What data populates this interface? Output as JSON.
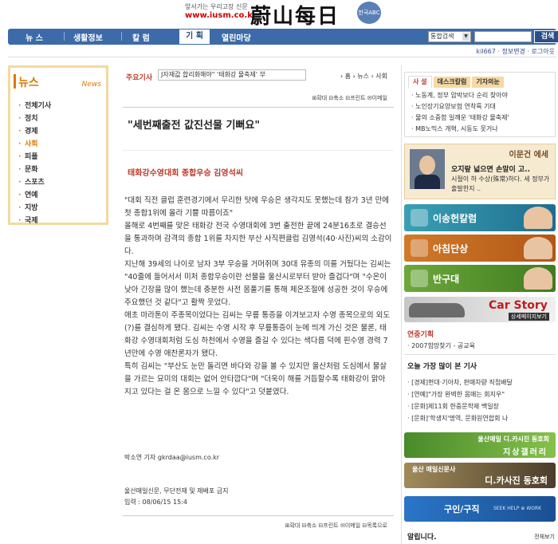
{
  "header": {
    "slogan": "앞서가는 우리고장 신문",
    "url": "www.iusm.co.kr",
    "logo": "蔚山每日",
    "badge": "한국ABC"
  },
  "nav": {
    "items": [
      "뉴 스",
      "생활정보",
      "칼 럼",
      "기 획",
      "열린마당"
    ],
    "active_index": 3,
    "search_select": "통합검색",
    "search_button": "검색"
  },
  "subline": "kil667 · 정보변경 · 로그아웃",
  "left": {
    "title": "뉴스",
    "title_en": "News",
    "menu": [
      "전체기사",
      "정치",
      "경제",
      "사회",
      "피플",
      "문화",
      "스포츠",
      "연예",
      "지방",
      "국제"
    ],
    "active": "사회"
  },
  "center": {
    "keyword_label": "주요기사",
    "keyword_value": "J자재값 합리화해야\"  '태화강 물축제' 부",
    "breadcrumb": "› 홈 › 뉴스 › 사회",
    "tools": "⊞확대 ⊟축소 ⊟프린트 ✉이메일",
    "tools_bottom": "⊞확대 ⊟축소 ⊟프린트 ✉이메일 ⊟목록으로",
    "headline": "\"세번째출전 값진선물 기뻐요\"",
    "subhead": "태화강수영대회 종합우승 김영석씨",
    "paragraphs": [
      "\"대회 직전 클럽 훈련경기에서 무리한 탓에 우승은 생각지도 못했는데 참가 3년 만에 첫 종합1위에 올라 기쁠 따름이죠\"",
      "올해로 4번째를 맞은 태화강 전국 수영대회에 3번 출전한 끝에 24분16초로 결승선을 통과하며 감격의 종합 1위를 차지한 부산 사직편클럽 김영석(40·사진)씨의 소감이다.",
      "지난해 39세의 나이로 남자 3부 우승을 거머쥐며 30대 유종의 미를 거뒀다는 김씨는 \"40줄에 들어서서 미처 종합우승이란 선물을 울산시로부터 받아 즐겁다\"며 \"수온이 낮아 긴장을 많이 했는데 충분한 사전 몸풀기를 통해 체온조절에 성공한 것이 우승에 주요했던 것 같다\"고 활짝 웃었다.",
      "애초 마라톤이 주종목이었다는 김씨는 무릎 통증을 이겨보고자 수영 종목으로의 외도(?)를 결심하게 됐다. 김씨는 수영 시작 후 무릎통증이 눈에 띄게 가신 것은 물론, 태화강 수영대회처럼 도심 하천에서 수영을 즐길 수 있다는 색다름 덕에 핀수영 경력 7년만에 수영 애찬론자가 됐다.",
      "특히 김씨는 \"부산도 눈만 돌리면 바다와 강을 볼 수 있지만 울산처럼 도심에서 물살을 가르는 묘미의 대회는 없어 안타깝다\"며 \"더욱이 해를 거듭할수록 태화강이 맑아지고 있다는 걸 온 몸으로 느낄 수 있다\"고 덧붙였다."
    ],
    "byline": "박소연 기자   gkrdaa@iusm.co.kr",
    "copyright": "울산매일신문, 무단전재 및 재배포 금지",
    "published": "입력 : 08/06/15 15:4"
  },
  "right": {
    "editorial_tabs": [
      "사 설",
      "데스크칼럼",
      "기자의눈"
    ],
    "editorial_items": [
      "· 노동계, 정부 압박보다 순리 찾아야",
      "· 노인장기요양보험 연착륙 기대",
      "· 물의 소중함 일깨운 '태화강 물축제'",
      "· MB노믹스 개혁, 시동도 못거나"
    ],
    "column": {
      "name": "이문건 에세",
      "title": "오지랖 넓으면 손말이 고..",
      "desc": "시절이 하 수상(殊常)하다. 세 정부가 출발한지 .."
    },
    "banners": [
      "이송헌칼럼",
      "아침단상",
      "반구대"
    ],
    "car_story": {
      "title": "Car Story",
      "sub": "상세페이지보기"
    },
    "hot_title": "연중기획",
    "hot_item": "· 2007힘망찾기 - 공교육",
    "most_title": "오늘 가장 많이 본 기사",
    "most_items": [
      "· [경제]현대·기아차, 판매차량 직접배달",
      "· [연예]\"가장 완벽한 몸매는 회지우\"",
      "· [문화]제11회 한중문학제 백일장",
      "· [문화]'학생지'명역, 문화원연합회 나"
    ],
    "gallery_1": {
      "top": "울산매일 디.카시진 동호회",
      "main": "지상갤러리"
    },
    "gallery_2": {
      "top": "울산 매일신문사",
      "main": "디.카사진 동호회"
    },
    "gallery_3": {
      "main": "구인/구직",
      "sub": "SEEK HELP ⊕ WORK"
    },
    "notice_title": "알립니다.",
    "notice_more": "전체보기"
  }
}
